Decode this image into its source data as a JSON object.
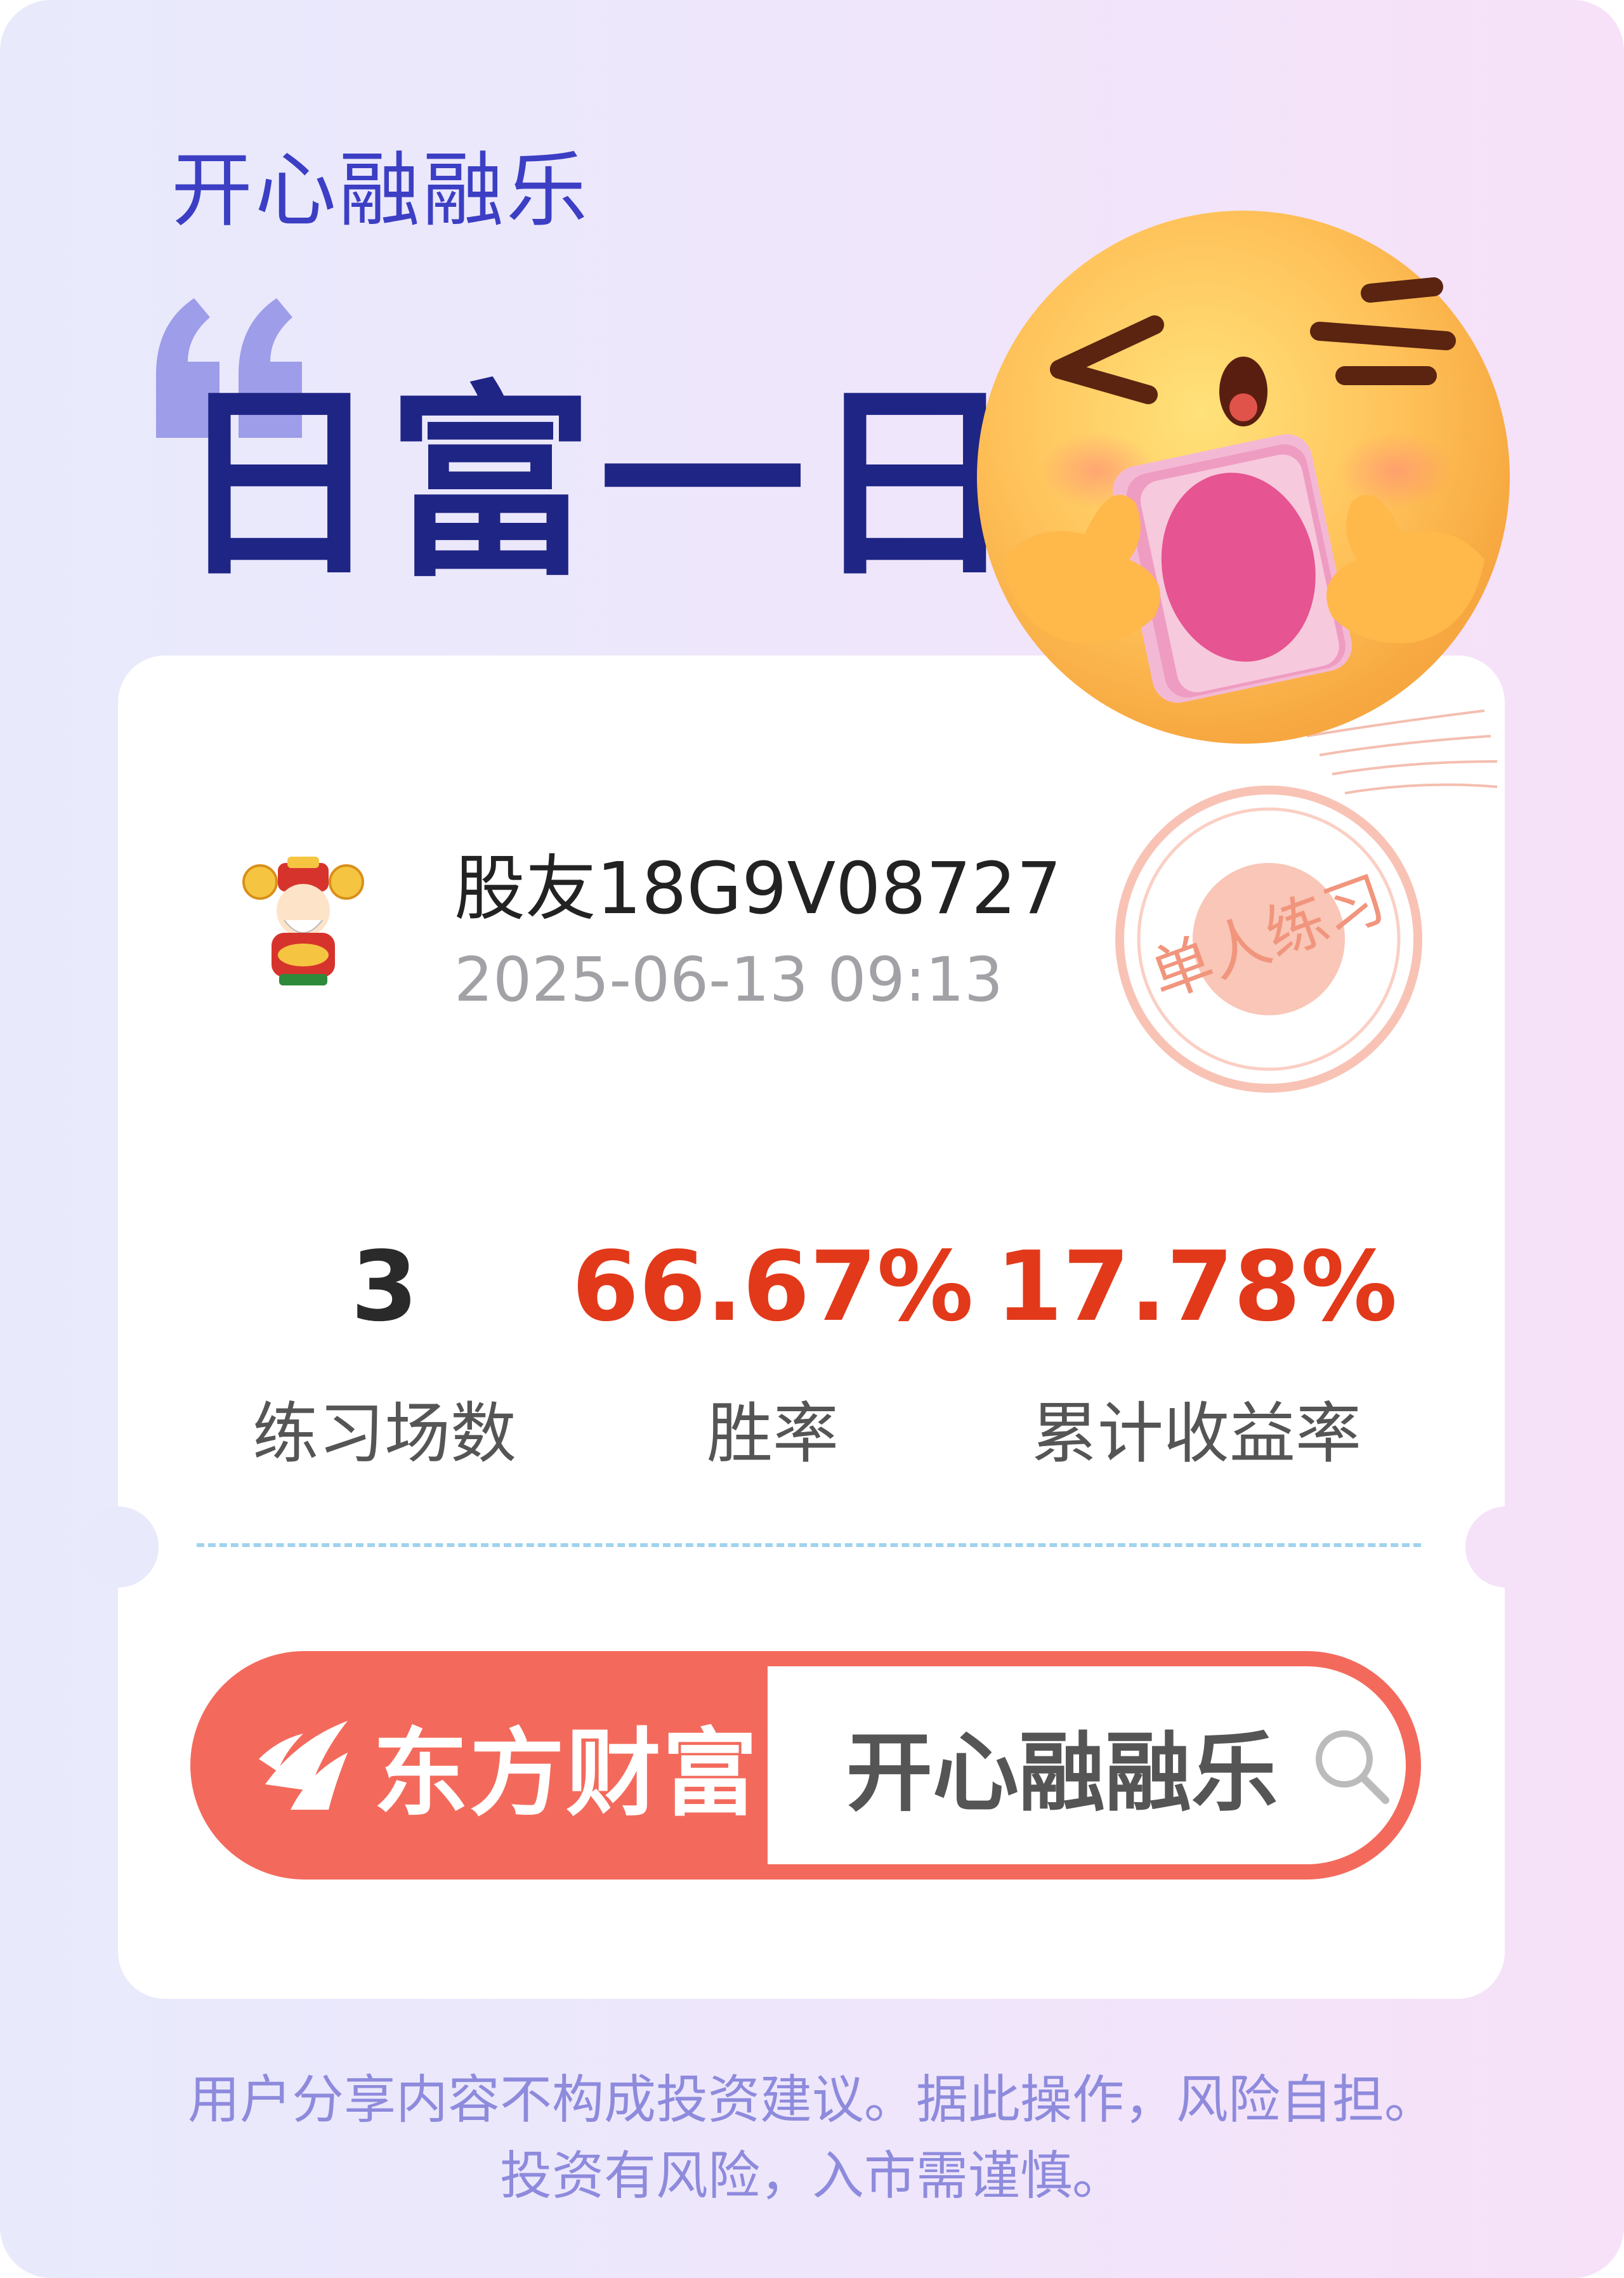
{
  "header": {
    "app_title": "开心融融乐",
    "headline": "日富一日"
  },
  "profile": {
    "username": "股友18G9V08727",
    "timestamp": "2025-06-13 09:13",
    "stamp_text": "单人练习"
  },
  "stats": [
    {
      "value": "3",
      "label": "练习场数"
    },
    {
      "value": "66.67%",
      "label": "胜率"
    },
    {
      "value": "17.78%",
      "label": "累计收益率"
    }
  ],
  "brand": {
    "name": "东方财富",
    "search_text": "开心融融乐"
  },
  "footer": {
    "line1": "用户分享内容不构成投资建议。据此操作，风险自担。",
    "line2": "投资有风险，入市需谨慎。"
  },
  "colors": {
    "title_blue": "#3c3fc4",
    "headline_navy": "#1f2585",
    "stat_red": "#e2391a",
    "brand_coral": "#f36a5c",
    "disclaimer_purple": "#8e8bdd"
  }
}
